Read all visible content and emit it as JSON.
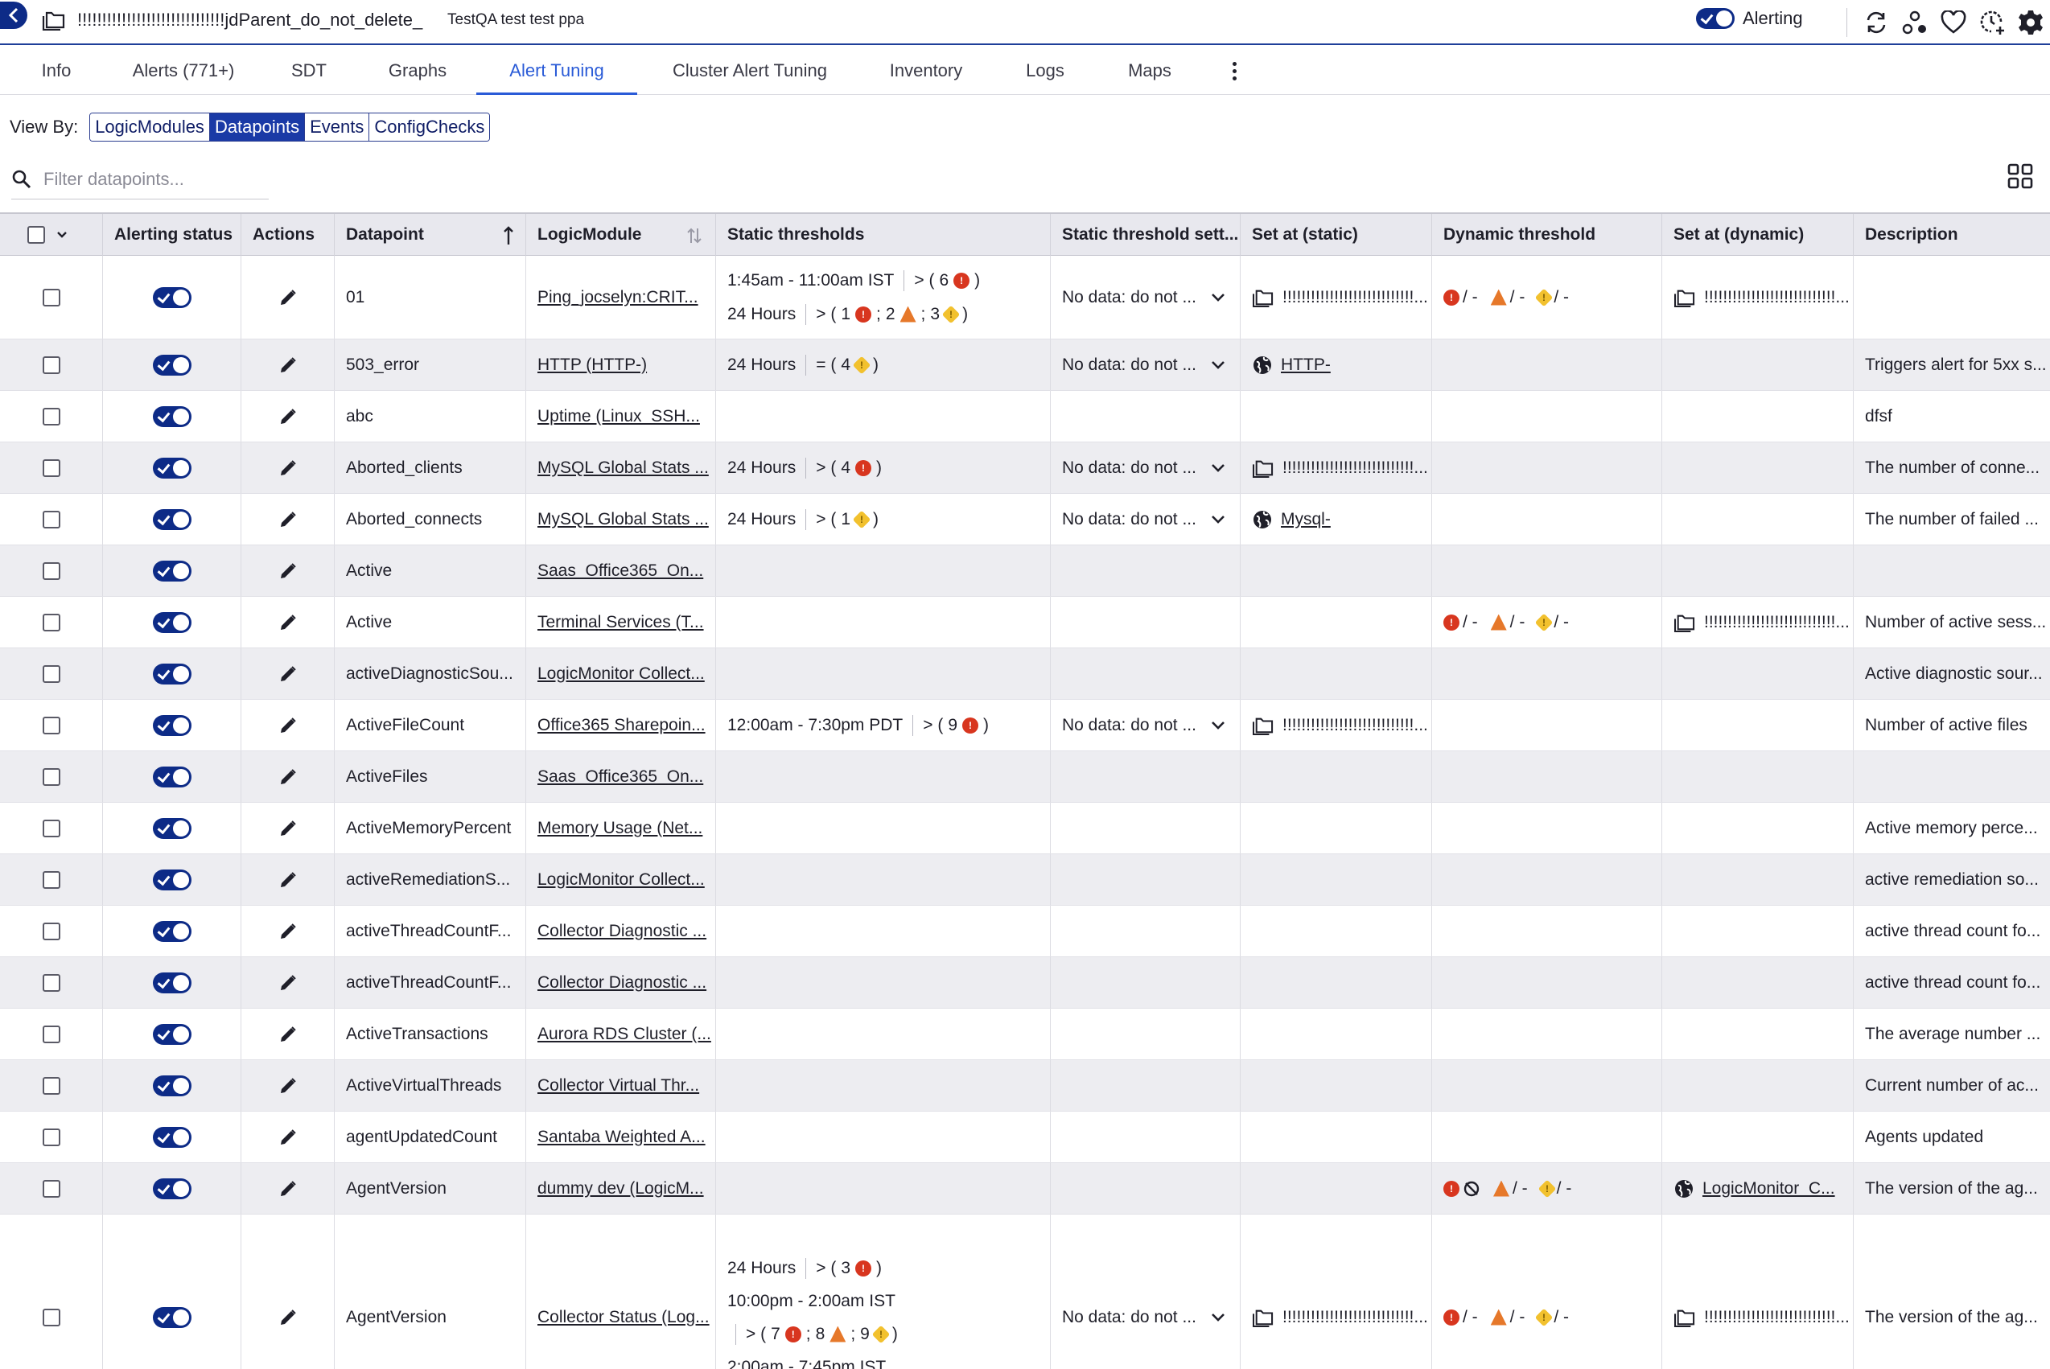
{
  "header": {
    "title": "!!!!!!!!!!!!!!!!!!!!!!!!!!!!!!jdParent_do_not_delete_",
    "subtitle": "TestQA test test ppa",
    "alerting_label": "Alerting"
  },
  "tabs": [
    {
      "label": "Info"
    },
    {
      "label": "Alerts (771+)"
    },
    {
      "label": "SDT"
    },
    {
      "label": "Graphs"
    },
    {
      "label": "Alert Tuning"
    },
    {
      "label": "Cluster Alert Tuning"
    },
    {
      "label": "Inventory"
    },
    {
      "label": "Logs"
    },
    {
      "label": "Maps"
    }
  ],
  "view_by": {
    "label": "View By:",
    "options": [
      "LogicModules",
      "Datapoints",
      "Events",
      "ConfigChecks"
    ],
    "selected": "Datapoints"
  },
  "filter": {
    "placeholder": "Filter datapoints..."
  },
  "columns": [
    {
      "label": ""
    },
    {
      "label": "Alerting status"
    },
    {
      "label": "Actions"
    },
    {
      "label": "Datapoint"
    },
    {
      "label": "LogicModule"
    },
    {
      "label": "Static thresholds"
    },
    {
      "label": "Static threshold sett..."
    },
    {
      "label": "Set at (static)"
    },
    {
      "label": "Dynamic threshold"
    },
    {
      "label": "Set at (dynamic)"
    },
    {
      "label": "Description"
    }
  ],
  "rows": [
    {
      "datapoint": "01",
      "module": "Ping_jocselyn:CRIT...",
      "static": [
        "1:45am - 11:00am IST|> (6 C)",
        "24 Hours|> (1 C; 2 E; 3 W)"
      ],
      "setting": "No data: do not ...",
      "set_static": {
        "icon": "folder",
        "text": "!!!!!!!!!!!!!!!!!!!!!!!!!!!!..."
      },
      "dynamic": "std",
      "set_dynamic": {
        "icon": "folder",
        "text": "!!!!!!!!!!!!!!!!!!!!!!!!!!!!..."
      },
      "description": ""
    },
    {
      "datapoint": "503_error",
      "module": "HTTP (HTTP-)",
      "static": [
        "24 Hours|= (4 W)"
      ],
      "setting": "No data: do not ...",
      "set_static": {
        "icon": "globe",
        "text": "HTTP-"
      },
      "dynamic": "",
      "set_dynamic": null,
      "description": "Triggers alert for 5xx s..."
    },
    {
      "datapoint": "abc",
      "module": "Uptime (Linux_SSH...",
      "static": [],
      "setting": "",
      "set_static": null,
      "dynamic": "",
      "set_dynamic": null,
      "description": "dfsf"
    },
    {
      "datapoint": "Aborted_clients",
      "module": "MySQL Global Stats ...",
      "static": [
        "24 Hours|> (4 C)"
      ],
      "setting": "No data: do not ...",
      "set_static": {
        "icon": "folder",
        "text": "!!!!!!!!!!!!!!!!!!!!!!!!!!!!..."
      },
      "dynamic": "",
      "set_dynamic": null,
      "description": "The number of conne..."
    },
    {
      "datapoint": "Aborted_connects",
      "module": "MySQL Global Stats ...",
      "static": [
        "24 Hours|> (1 W)"
      ],
      "setting": "No data: do not ...",
      "set_static": {
        "icon": "globe",
        "text": "Mysql-"
      },
      "dynamic": "",
      "set_dynamic": null,
      "description": "The number of failed ..."
    },
    {
      "datapoint": "Active",
      "module": "Saas_Office365_On...",
      "static": [],
      "setting": "",
      "set_static": null,
      "dynamic": "",
      "set_dynamic": null,
      "description": ""
    },
    {
      "datapoint": "Active",
      "module": "Terminal Services (T...",
      "static": [],
      "setting": "",
      "set_static": null,
      "dynamic": "std",
      "set_dynamic": {
        "icon": "folder",
        "text": "!!!!!!!!!!!!!!!!!!!!!!!!!!!!..."
      },
      "description": "Number of active sess..."
    },
    {
      "datapoint": "activeDiagnosticSou...",
      "module": "LogicMonitor Collect...",
      "static": [],
      "setting": "",
      "set_static": null,
      "dynamic": "",
      "set_dynamic": null,
      "description": "Active diagnostic sour..."
    },
    {
      "datapoint": "ActiveFileCount",
      "module": "Office365 Sharepoin...",
      "static": [
        "12:00am - 7:30pm PDT|> (9 C)"
      ],
      "setting": "No data: do not ...",
      "set_static": {
        "icon": "folder",
        "text": "!!!!!!!!!!!!!!!!!!!!!!!!!!!!..."
      },
      "dynamic": "",
      "set_dynamic": null,
      "description": "Number of active files"
    },
    {
      "datapoint": "ActiveFiles",
      "module": "Saas_Office365_On...",
      "static": [],
      "setting": "",
      "set_static": null,
      "dynamic": "",
      "set_dynamic": null,
      "description": ""
    },
    {
      "datapoint": "ActiveMemoryPercent",
      "module": "Memory Usage (Net...",
      "static": [],
      "setting": "",
      "set_static": null,
      "dynamic": "",
      "set_dynamic": null,
      "description": "Active memory perce..."
    },
    {
      "datapoint": "activeRemediationS...",
      "module": "LogicMonitor Collect...",
      "static": [],
      "setting": "",
      "set_static": null,
      "dynamic": "",
      "set_dynamic": null,
      "description": "active remediation so..."
    },
    {
      "datapoint": "activeThreadCountF...",
      "module": "Collector Diagnostic ...",
      "static": [],
      "setting": "",
      "set_static": null,
      "dynamic": "",
      "set_dynamic": null,
      "description": "active thread count fo..."
    },
    {
      "datapoint": "activeThreadCountF...",
      "module": "Collector Diagnostic ...",
      "static": [],
      "setting": "",
      "set_static": null,
      "dynamic": "",
      "set_dynamic": null,
      "description": "active thread count fo..."
    },
    {
      "datapoint": "ActiveTransactions",
      "module": "Aurora RDS Cluster (...",
      "static": [],
      "setting": "",
      "set_static": null,
      "dynamic": "",
      "set_dynamic": null,
      "description": "The average number ..."
    },
    {
      "datapoint": "ActiveVirtualThreads",
      "module": "Collector Virtual Thr...",
      "static": [],
      "setting": "",
      "set_static": null,
      "dynamic": "",
      "set_dynamic": null,
      "description": "Current number of ac..."
    },
    {
      "datapoint": "agentUpdatedCount",
      "module": "Santaba Weighted A...",
      "static": [],
      "setting": "",
      "set_static": null,
      "dynamic": "",
      "set_dynamic": null,
      "description": "Agents updated"
    },
    {
      "datapoint": "AgentVersion",
      "module": "dummy dev (LogicM...",
      "static": [],
      "setting": "",
      "set_static": null,
      "dynamic": "off",
      "set_dynamic": {
        "icon": "globe",
        "text": "LogicMonitor_C..."
      },
      "description": "The version of the ag..."
    },
    {
      "datapoint": "AgentVersion",
      "module": "Collector Status (Log...",
      "static": [
        "24 Hours|> (3 C)",
        "10:00pm - 2:00am IST|",
        "|> (7 C; 8 E; 9 W)",
        "2:00am - 7:45pm IST|"
      ],
      "setting": "No data: do not ...",
      "set_static": {
        "icon": "folder",
        "text": "!!!!!!!!!!!!!!!!!!!!!!!!!!!!..."
      },
      "dynamic": "std",
      "set_dynamic": {
        "icon": "folder",
        "text": "!!!!!!!!!!!!!!!!!!!!!!!!!!!!..."
      },
      "description": "The version of the ag..."
    }
  ],
  "colors": {
    "brand": "#0d2b87",
    "active_tab": "#2a5bd7",
    "critical": "#d8361f",
    "error": "#e6782a",
    "warning": "#f2c12e"
  }
}
